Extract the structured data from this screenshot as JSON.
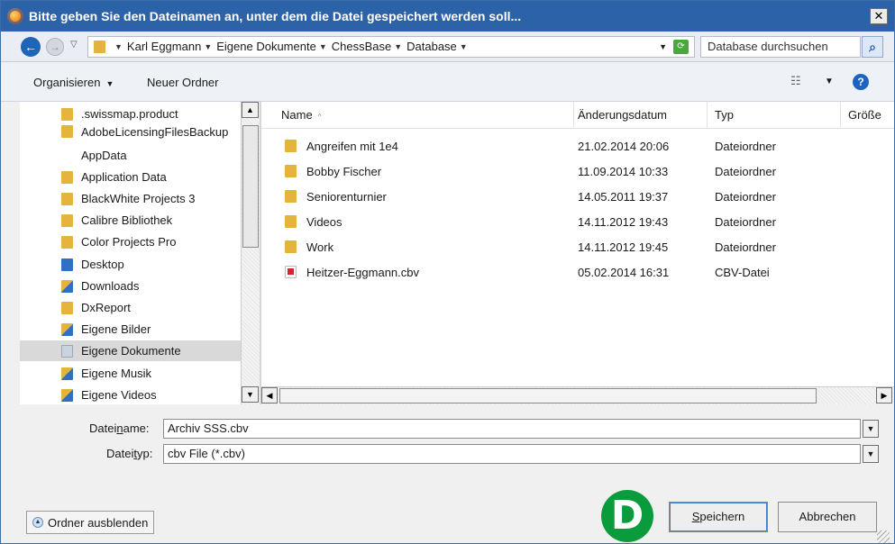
{
  "window": {
    "title": "Bitte geben Sie den Dateinamen an, unter dem die Datei gespeichert werden soll...",
    "close_glyph": "✕"
  },
  "address": {
    "breadcrumbs": [
      "Karl Eggmann",
      "Eigene Dokumente",
      "ChessBase",
      "Database"
    ],
    "search_placeholder": "Database durchsuchen"
  },
  "toolbar": {
    "organize_label": "Organisieren",
    "new_folder_label": "Neuer Ordner",
    "help_glyph": "?"
  },
  "sidebar": {
    "items": [
      {
        "label": ".swissmap.product",
        "icon": "folder-icon"
      },
      {
        "label": "AdobeLicensingFilesBackup",
        "icon": "folder-icon"
      },
      {
        "label": "AppData",
        "icon": "folder-icon"
      },
      {
        "label": "Application Data",
        "icon": "folder-icon"
      },
      {
        "label": "BlackWhite Projects 3",
        "icon": "folder-icon"
      },
      {
        "label": "Calibre Bibliothek",
        "icon": "folder-icon"
      },
      {
        "label": "Color Projects Pro",
        "icon": "folder-icon"
      },
      {
        "label": "Desktop",
        "icon": "desktop-folder-icon"
      },
      {
        "label": "Downloads",
        "icon": "downloads-folder-icon"
      },
      {
        "label": "DxReport",
        "icon": "folder-icon"
      },
      {
        "label": "Eigene Bilder",
        "icon": "pictures-folder-icon"
      },
      {
        "label": "Eigene Dokumente",
        "icon": "documents-folder-icon",
        "selected": true
      },
      {
        "label": "Eigene Musik",
        "icon": "music-folder-icon"
      },
      {
        "label": "Eigene Videos",
        "icon": "videos-folder-icon"
      }
    ]
  },
  "filelist": {
    "columns": [
      "Name",
      "Änderungsdatum",
      "Typ",
      "Größe"
    ],
    "rows": [
      {
        "name": "Angreifen mit 1e4",
        "date": "21.02.2014 20:06",
        "type": "Dateiordner",
        "icon": "folder-icon"
      },
      {
        "name": "Bobby Fischer",
        "date": "11.09.2014 10:33",
        "type": "Dateiordner",
        "icon": "folder-icon"
      },
      {
        "name": "Seniorenturnier",
        "date": "14.05.2011 19:37",
        "type": "Dateiordner",
        "icon": "folder-icon"
      },
      {
        "name": "Videos",
        "date": "14.11.2012 19:43",
        "type": "Dateiordner",
        "icon": "folder-icon"
      },
      {
        "name": "Work",
        "date": "14.11.2012 19:45",
        "type": "Dateiordner",
        "icon": "folder-icon"
      },
      {
        "name": "Heitzer-Eggmann.cbv",
        "date": "05.02.2014 16:31",
        "type": "CBV-Datei",
        "icon": "cbv-file-icon"
      }
    ]
  },
  "form": {
    "filename_label_pre": "Datei",
    "filename_label_u": "n",
    "filename_label_post": "ame:",
    "filename_value": "Archiv SSS.cbv",
    "filetype_label_pre": "Datei",
    "filetype_label_u": "t",
    "filetype_label_post": "yp:",
    "filetype_value": "cbv File (*.cbv)"
  },
  "footer": {
    "hide_folders_label": "Ordner ausblenden",
    "logo_letter": "D",
    "save_label_u": "S",
    "save_label_rest": "peichern",
    "cancel_label": "Abbrechen"
  },
  "colors": {
    "title_bar": "#2b62a8",
    "folder": "#e4b43c",
    "logo_green": "#0a9c3c",
    "selection": "#d9d9d9"
  }
}
